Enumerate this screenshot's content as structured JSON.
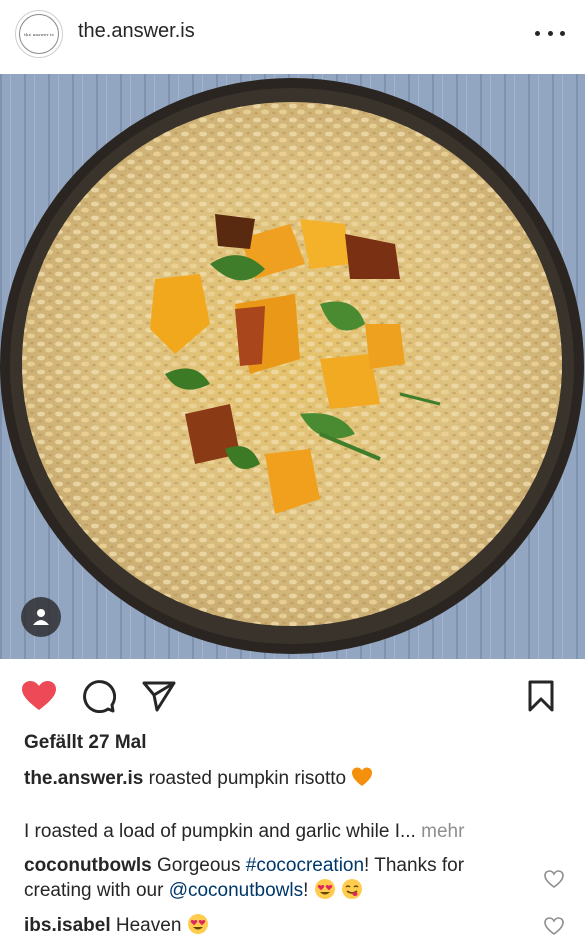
{
  "header": {
    "avatar_text": "the answer is",
    "username": "the.answer.is"
  },
  "actions": {
    "like_color": "#ed4956"
  },
  "likes": {
    "text": "Gefällt 27 Mal"
  },
  "caption": {
    "user": "the.answer.is",
    "text": "roasted pumpkin risotto",
    "emoji": "orange-heart"
  },
  "full_caption": {
    "text": "I roasted a load of pumpkin and garlic while I...",
    "more_label": "mehr"
  },
  "comments": [
    {
      "user": "coconutbowls",
      "text_before": "Gorgeous",
      "hashtag": "#cococreation",
      "text_mid": "! Thanks for creating with our",
      "mention": "@coconutbowls",
      "text_after": "!",
      "emojis": [
        "heart-eyes",
        "yum-face"
      ]
    },
    {
      "user": "ibs.isabel",
      "text": "Heaven",
      "emojis": [
        "heart-eyes"
      ]
    }
  ]
}
